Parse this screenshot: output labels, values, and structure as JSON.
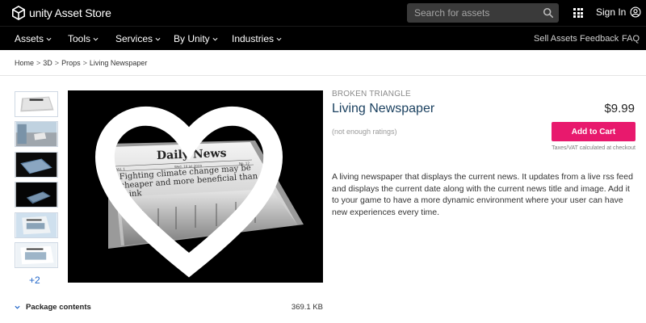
{
  "header": {
    "logo_text": "unity Asset Store",
    "search": {
      "placeholder": "Search for assets",
      "value": ""
    },
    "signin_label": "Sign In"
  },
  "nav": {
    "items": [
      {
        "label": "Assets"
      },
      {
        "label": "Tools"
      },
      {
        "label": "Services"
      },
      {
        "label": "By Unity"
      },
      {
        "label": "Industries"
      }
    ],
    "right_links": [
      {
        "label": "Sell Assets"
      },
      {
        "label": "Feedback"
      },
      {
        "label": "FAQ"
      }
    ]
  },
  "breadcrumb": [
    "Home",
    "3D",
    "Props",
    "Living Newspaper"
  ],
  "gallery": {
    "more_label": "+2",
    "image_text": {
      "masthead": "Daily News",
      "vol": "Vol. 1",
      "date": "Wed, 10 Jul 2019",
      "no": "No. 12",
      "headline": [
        "Fighting climate change may be",
        "cheaper and more beneficial than we",
        "think"
      ]
    }
  },
  "product": {
    "publisher": "BROKEN TRIANGLE",
    "title": "Living Newspaper",
    "price": "$9.99",
    "ratings": "(not enough ratings)",
    "cart_label": "Add to Cart",
    "tax_note": "Taxes/VAT calculated at checkout",
    "description": "A living newspaper that displays the current news. It updates from a live rss feed and displays the current date along with the current news title and image. Add it to your game to have a more dynamic environment where your user can have new experiences every time."
  },
  "package": {
    "label": "Package contents",
    "size": "369.1 KB"
  },
  "colors": {
    "accent": "#e8196d",
    "header_bg": "#000000",
    "title": "#1b4160",
    "link": "#2166c9"
  }
}
